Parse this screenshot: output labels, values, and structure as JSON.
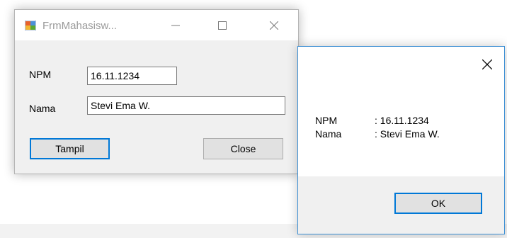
{
  "form": {
    "title": "FrmMahasisw...",
    "controls": {
      "minimize": "—",
      "maximize": "☐",
      "close": "✕"
    },
    "npm_label": "NPM",
    "npm_value": "16.11.1234",
    "nama_label": "Nama",
    "nama_value": "Stevi Ema W.",
    "tampil_label": "Tampil",
    "close_label": "Close",
    "icon": "windows-form-icon"
  },
  "messagebox": {
    "close_glyph": "✕",
    "line1_key": "NPM",
    "line1_value": ": 16.11.1234",
    "line2_key": "Nama",
    "line2_value": ": Stevi Ema W.",
    "ok_label": "OK"
  },
  "colors": {
    "focus_border": "#0078d7",
    "window_bg": "#f0f0f0",
    "button_bg": "#e1e1e1"
  }
}
